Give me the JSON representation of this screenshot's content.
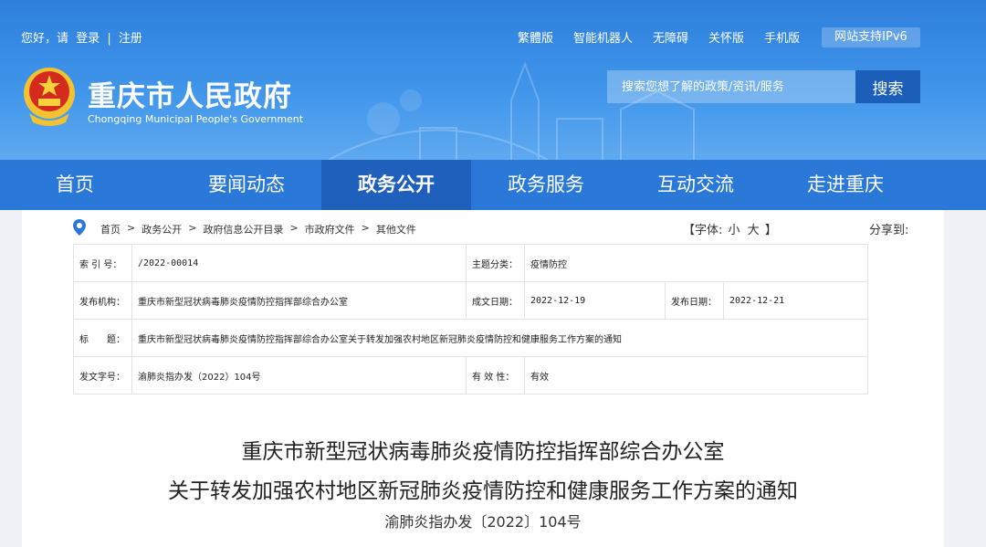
{
  "topbar": {
    "greeting": "您好，请",
    "login": "登录",
    "divider": "|",
    "register": "注册",
    "links": [
      "繁體版",
      "智能机器人",
      "无障碍",
      "关怀版",
      "手机版"
    ],
    "ipv6": "网站支持IPv6"
  },
  "logo": {
    "title": "重庆市人民政府",
    "subtitle": "Chongqing Municipal People's Government",
    "emblem_icon": "national-emblem-icon"
  },
  "search": {
    "placeholder": "搜索您想了解的政策/资讯/服务",
    "button": "搜索"
  },
  "nav": {
    "items": [
      "首页",
      "要闻动态",
      "政务公开",
      "政务服务",
      "互动交流",
      "走进重庆"
    ],
    "active": "政务公开"
  },
  "breadcrumb": {
    "icon": "location-pin-icon",
    "items": [
      "首页",
      "政务公开",
      "政府信息公开目录",
      "市政府文件",
      "其他文件"
    ],
    "separator": ">"
  },
  "font_size": {
    "open": "【字体:",
    "small": "小",
    "large": "大",
    "close": "】"
  },
  "share": "分享到:",
  "meta": {
    "index_label": "索 引 号：",
    "index_value": "/2022-00014",
    "topic_label": "主题分类：",
    "topic_value": "疫情防控",
    "issuer_label": "发布机构：",
    "issuer_value": "重庆市新型冠状病毒肺炎疫情防控指挥部综合办公室",
    "created_label": "成文日期：",
    "created_value": "2022-12-19",
    "published_label": "发布日期：",
    "published_value": "2022-12-21",
    "title_label": "标　　题：",
    "title_value": "重庆市新型冠状病毒肺炎疫情防控指挥部综合办公室关于转发加强农村地区新冠肺炎疫情防控和健康服务工作方案的通知",
    "docno_label": "发文字号：",
    "docno_value": "渝肺炎指办发（2022）104号",
    "validity_label": "有 效 性：",
    "validity_value": "有效"
  },
  "document": {
    "title_line1": "重庆市新型冠状病毒肺炎疫情防控指挥部综合办公室",
    "title_line2": "关于转发加强农村地区新冠肺炎疫情防控和健康服务工作方案的通知",
    "doc_number": "渝肺炎指办发〔2022〕104号"
  },
  "colors": {
    "header_blue": "#3f95ea",
    "nav_blue": "#2a78d8",
    "nav_active": "#2060bd",
    "search_button": "#1b5fb8",
    "page_bg": "#eef2f7"
  }
}
